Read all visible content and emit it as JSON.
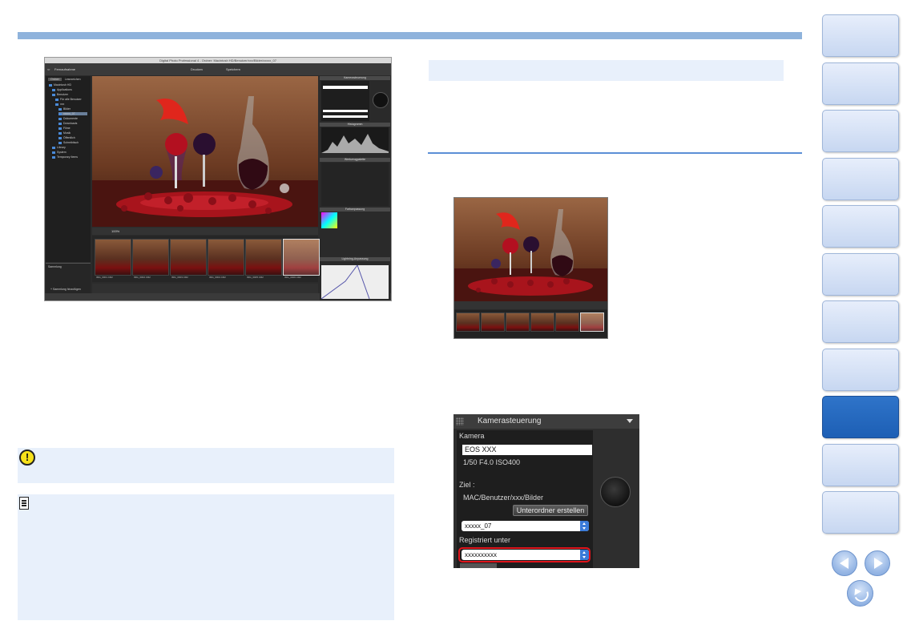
{
  "dpp_window": {
    "title": "Digital Photo Professional 4 - Ordner: Macintosh HD/Benutzer/xxx/Bilder/xxxxx_07",
    "toolbar_back": "Fernaufnahme",
    "toolbar_print": "Drucken",
    "toolbar_develop": "Speichern",
    "tree_tabs": [
      "Ordner",
      "Lesezeichen"
    ],
    "tree_items": [
      "Macintosh HD",
      "Applications",
      "Benutzer",
      "Für alle Benutzer",
      "xxx",
      "Bilder",
      "xxxxx_07",
      "Dokumente",
      "Downloads",
      "Filme",
      "Musik",
      "Öffentlich",
      "Schreibtisch",
      "Library",
      "System",
      "Temporary Items"
    ],
    "collection_label": "Sammlung",
    "collection_add": "+ Sammlung hinzufügen",
    "zoom_value": "100%",
    "thumb_labels": [
      "IMG_0001.CR2",
      "IMG_0002.CR2",
      "IMG_0003.CR2",
      "IMG_0004.CR2",
      "IMG_0005.CR2",
      "IMG_0006.CR2"
    ],
    "panel_headers": [
      "Kamerasteuerung",
      "Histogramm",
      "Werkzeugpalette",
      "Farbanpassung",
      "Lightning-Anpassung"
    ],
    "status_right": "sRGB / sRGB"
  },
  "kamera_panel": {
    "header": "Kamerasteuerung",
    "camera_label": "Kamera",
    "camera_value": "EOS XXX",
    "settings": "1/50  F4.0  ISO400",
    "ziel_label": "Ziel :",
    "path": "MAC/Benutzer/xxx/Bilder",
    "subfolder_button": "Unterordner erstellen",
    "folder_select": "xxxxx_07",
    "registered_label": "Registriert unter",
    "registered_select": "xxxxxxxxxx"
  },
  "colors": {
    "accent_blue": "#5b8fd6",
    "note_bg": "#e8f0fb",
    "active_tab": "#1d5fb5",
    "highlight_red": "#e0141b"
  },
  "icons": [
    "caution-icon",
    "memo-icon",
    "prev-page-icon",
    "next-page-icon",
    "return-icon"
  ]
}
